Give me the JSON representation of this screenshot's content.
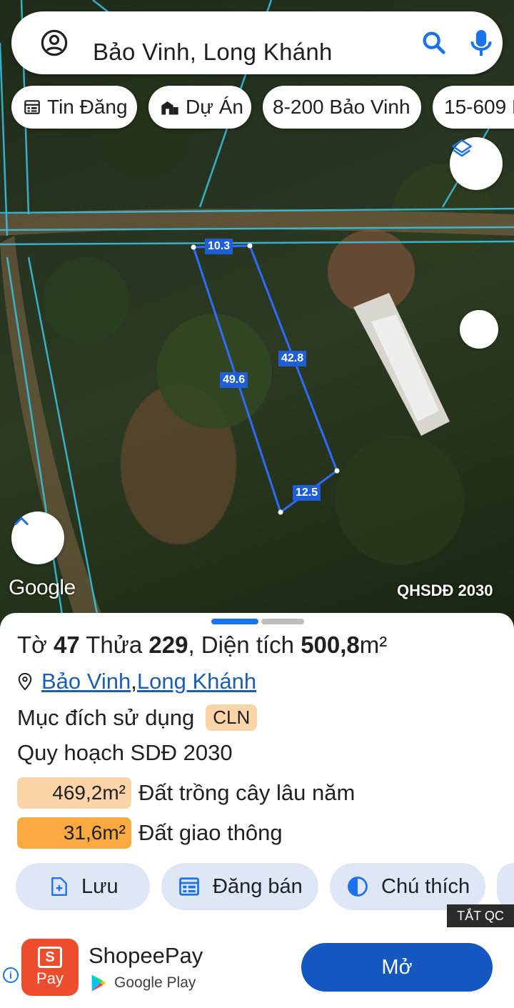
{
  "search": {
    "query": "Bảo Vinh, Long Khánh"
  },
  "chips": [
    {
      "label": "Tin Đăng",
      "icon": "calendar-list-icon"
    },
    {
      "label": "Dự Án",
      "icon": "building-icon"
    },
    {
      "label": "8-200 Bảo Vinh"
    },
    {
      "label": "15-609 B"
    }
  ],
  "map": {
    "google_label": "Google",
    "plan_label": "QHSDĐ 2030",
    "dimensions": {
      "top": "10.3",
      "right": "42.8",
      "left": "49.6",
      "bottom": "12.5"
    }
  },
  "sheet": {
    "title": {
      "prefix": "Tờ ",
      "sheet_no": "47",
      "mid1": " Thửa ",
      "parcel_no": "229",
      "mid2": ", Diện tích ",
      "area": "500,8",
      "unit": "m²"
    },
    "location": {
      "ward": "Bảo Vinh",
      "separator": ", ",
      "city": "Long Khánh"
    },
    "purpose_label": "Mục đích sử dụng",
    "purpose_code": "CLN",
    "plan_title": "Quy hoạch SDĐ 2030",
    "zones": [
      {
        "area": "469,2m²",
        "label": "Đất trồng cây lâu năm",
        "color": "#fbd4a8"
      },
      {
        "area": "31,6m²",
        "label": "Đất giao thông",
        "color": "#f9a940"
      }
    ],
    "actions": [
      {
        "label": "Lưu",
        "icon": "add-document-icon"
      },
      {
        "label": "Đăng bán",
        "icon": "calendar-list-icon"
      },
      {
        "label": "Chú thích",
        "icon": "contrast-icon"
      }
    ]
  },
  "ad": {
    "tag": "TẮT QC",
    "logo_text": "Pay",
    "logo_letter": "S",
    "app_name": "ShopeePay",
    "store": "Google Play",
    "open_label": "Mở"
  },
  "colors": {
    "accent": "#1a73e8",
    "parcel_line": "#2f6bff",
    "open_button": "#1557c0"
  }
}
